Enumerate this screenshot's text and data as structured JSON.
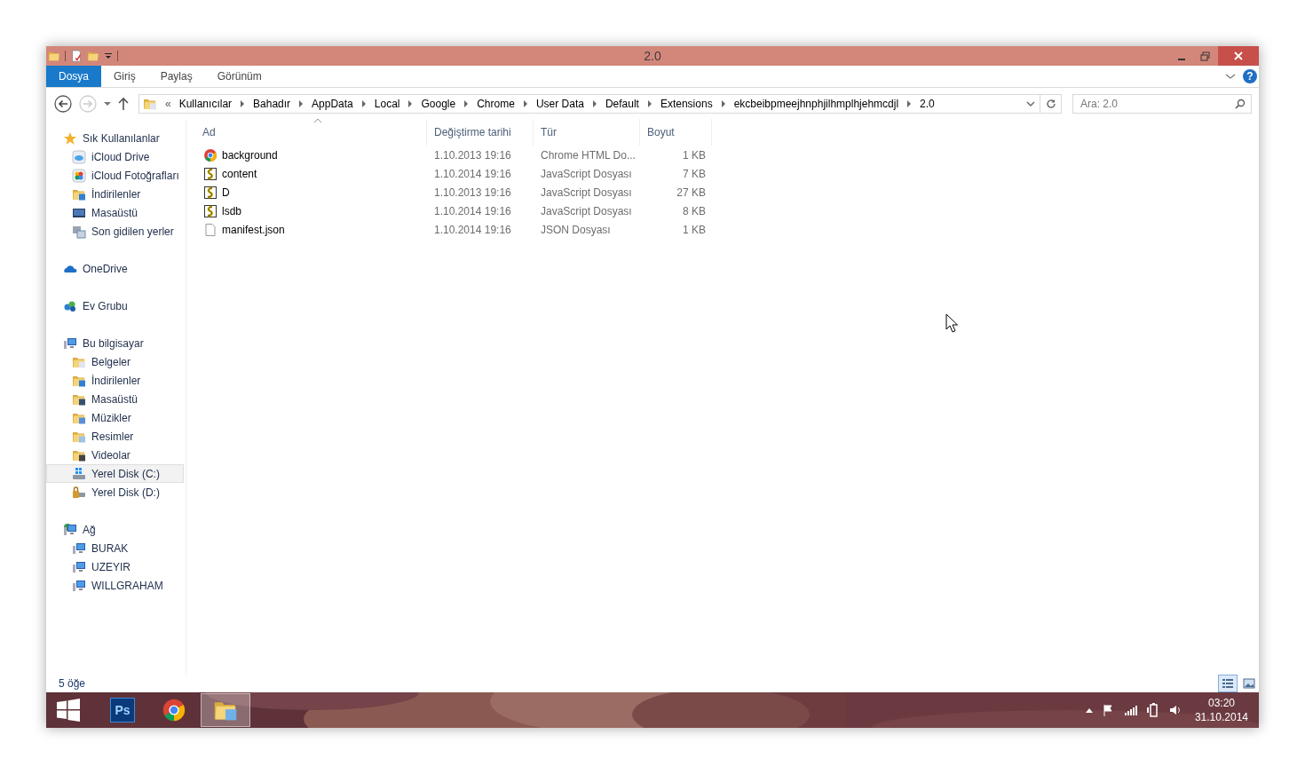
{
  "window": {
    "title": "2.0"
  },
  "ribbon": {
    "tabs": [
      {
        "label": "Dosya",
        "selected": true
      },
      {
        "label": "Giriş",
        "selected": false
      },
      {
        "label": "Paylaş",
        "selected": false
      },
      {
        "label": "Görünüm",
        "selected": false
      }
    ],
    "help": "?"
  },
  "address": {
    "overflow": "«",
    "crumbs": [
      "Kullanıcılar",
      "Bahadır",
      "AppData",
      "Local",
      "Google",
      "Chrome",
      "User Data",
      "Default",
      "Extensions",
      "ekcbeibpmeejhnphjilhmplhjehmcdjl",
      "2.0"
    ]
  },
  "search": {
    "placeholder": "Ara: 2.0"
  },
  "sidebar": {
    "groups": [
      {
        "label": "Sık Kullanılanlar",
        "kind": "star",
        "selected": false,
        "children": [
          {
            "label": "iCloud Drive",
            "kind": "icloud",
            "selected": false
          },
          {
            "label": "iCloud Fotoğrafları",
            "kind": "photos",
            "selected": false
          },
          {
            "label": "İndirilenler",
            "kind": "folder-download",
            "selected": false
          },
          {
            "label": "Masaüstü",
            "kind": "desktop",
            "selected": false
          },
          {
            "label": "Son gidilen yerler",
            "kind": "recent",
            "selected": false
          }
        ]
      },
      {
        "label": "OneDrive",
        "kind": "onedrive",
        "selected": false
      },
      {
        "label": "Ev Grubu",
        "kind": "homegroup",
        "selected": false
      },
      {
        "label": "Bu bilgisayar",
        "kind": "pc",
        "selected": false,
        "children": [
          {
            "label": "Belgeler",
            "kind": "folder-docs",
            "selected": false
          },
          {
            "label": "İndirilenler",
            "kind": "folder-download",
            "selected": false
          },
          {
            "label": "Masaüstü",
            "kind": "folder-desktop",
            "selected": false
          },
          {
            "label": "Müzikler",
            "kind": "folder-music",
            "selected": false
          },
          {
            "label": "Resimler",
            "kind": "folder-pictures",
            "selected": false
          },
          {
            "label": "Videolar",
            "kind": "folder-video",
            "selected": false
          },
          {
            "label": "Yerel Disk (C:)",
            "kind": "drive-system",
            "selected": true
          },
          {
            "label": "Yerel Disk (D:)",
            "kind": "drive-locked",
            "selected": false
          }
        ]
      },
      {
        "label": "Ağ",
        "kind": "network",
        "selected": false,
        "children": [
          {
            "label": "BURAK",
            "kind": "pc",
            "selected": false
          },
          {
            "label": "UZEYIR",
            "kind": "pc",
            "selected": false
          },
          {
            "label": "WILLGRAHAM",
            "kind": "pc",
            "selected": false
          }
        ]
      }
    ]
  },
  "table": {
    "columns": [
      {
        "label": "Ad",
        "sorted": true
      },
      {
        "label": "Değiştirme tarihi",
        "sorted": false
      },
      {
        "label": "Tür",
        "sorted": false
      },
      {
        "label": "Boyut",
        "sorted": false
      }
    ],
    "rows": [
      {
        "name": "background",
        "kind": "chrome",
        "date": "1.10.2013 19:16",
        "type": "Chrome HTML Do...",
        "size": "1 KB"
      },
      {
        "name": "content",
        "kind": "script",
        "date": "1.10.2014 19:16",
        "type": "JavaScript Dosyası",
        "size": "7 KB"
      },
      {
        "name": "D",
        "kind": "script",
        "date": "1.10.2013 19:16",
        "type": "JavaScript Dosyası",
        "size": "27 KB"
      },
      {
        "name": "lsdb",
        "kind": "script",
        "date": "1.10.2014 19:16",
        "type": "JavaScript Dosyası",
        "size": "8 KB"
      },
      {
        "name": "manifest.json",
        "kind": "blank",
        "date": "1.10.2014 19:16",
        "type": "JSON Dosyası",
        "size": "1 KB"
      }
    ]
  },
  "status_bar": {
    "count": "5 öğe",
    "views": [
      {
        "kind": "details",
        "selected": true
      },
      {
        "kind": "large",
        "selected": false
      }
    ]
  },
  "taskbar": {
    "apps": [
      {
        "kind": "photoshop",
        "label": "Ps",
        "selected": false
      },
      {
        "kind": "chrome",
        "selected": false
      },
      {
        "kind": "explorer",
        "selected": true
      }
    ],
    "time": "03:20",
    "date": "31.10.2014"
  }
}
